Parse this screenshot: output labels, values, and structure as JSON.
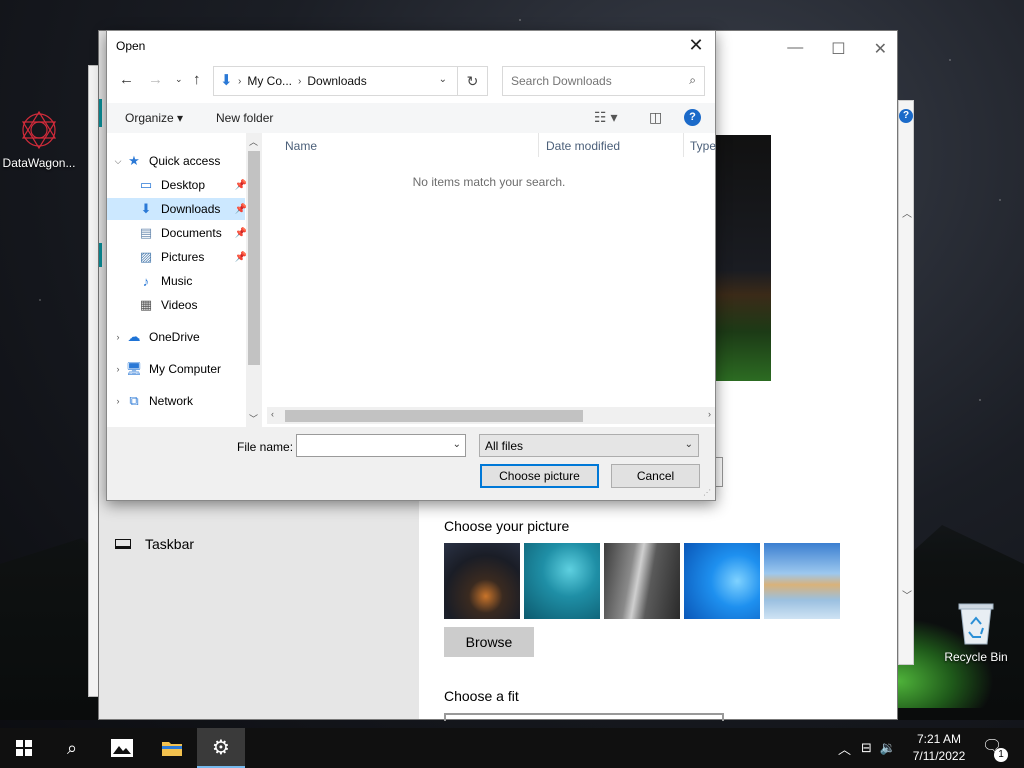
{
  "desktop": {
    "icons": [
      {
        "label": "DataWagon..."
      },
      {
        "label": "Recycle Bin"
      }
    ]
  },
  "settings": {
    "side_item": "Taskbar",
    "choose_picture": "Choose your picture",
    "browse": "Browse",
    "choose_fit": "Choose a fit",
    "window_controls": {
      "minimize": "—",
      "maximize": "☐",
      "close": "✕"
    }
  },
  "dialog": {
    "title": "Open",
    "close": "✕",
    "breadcrumb": [
      "My Co...",
      "Downloads"
    ],
    "search_placeholder": "Search Downloads",
    "toolbar": {
      "organize": "Organize",
      "new_folder": "New folder"
    },
    "nav": [
      {
        "label": "Quick access",
        "icon": "star-icon"
      },
      {
        "label": "Desktop",
        "icon": "desktop-icon"
      },
      {
        "label": "Downloads",
        "icon": "download-icon"
      },
      {
        "label": "Documents",
        "icon": "document-icon"
      },
      {
        "label": "Pictures",
        "icon": "pictures-icon"
      },
      {
        "label": "Music",
        "icon": "music-icon"
      },
      {
        "label": "Videos",
        "icon": "video-icon"
      },
      {
        "label": "OneDrive",
        "icon": "cloud-icon"
      },
      {
        "label": "My Computer",
        "icon": "computer-icon"
      },
      {
        "label": "Network",
        "icon": "network-icon"
      }
    ],
    "columns": [
      "Name",
      "Date modified",
      "Type"
    ],
    "empty_message": "No items match your search.",
    "file_name_label": "File name:",
    "file_name_value": "",
    "filter": "All files",
    "choose_button": "Choose picture",
    "cancel_button": "Cancel"
  },
  "taskbar": {
    "time": "7:21 AM",
    "date": "7/11/2022",
    "notifications": "1"
  },
  "colors": {
    "accent": "#0078d7",
    "selected": "#cce8ff",
    "teal_accent": "#0a8f9a"
  }
}
